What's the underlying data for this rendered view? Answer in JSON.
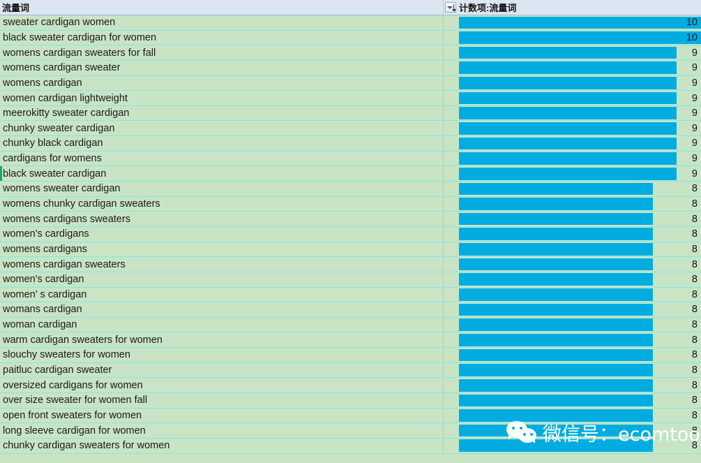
{
  "header": {
    "left_label": "流量词",
    "right_label": "计数项:流量词",
    "filter_icon": "filter-sort-dropdown-icon"
  },
  "chart_data": {
    "type": "bar",
    "title": "计数项:流量词",
    "xlabel": "",
    "ylabel": "流量词",
    "orientation": "horizontal",
    "value_column_header": "计数项:流量词",
    "category_column_header": "流量词",
    "grid": false,
    "legend": "none",
    "xlim": [
      0,
      10
    ],
    "categories": [
      "sweater cardigan women",
      "black sweater cardigan for women",
      "womens cardigan sweaters for fall",
      "womens cardigan sweater",
      "womens cardigan",
      "women cardigan lightweight",
      "meerokitty sweater cardigan",
      "chunky sweater cardigan",
      "chunky black cardigan",
      "cardigans for womens",
      "black sweater cardigan",
      "womens sweater cardigan",
      "womens chunky cardigan sweaters",
      "womens cardigans sweaters",
      "women's cardigans",
      "womens cardigans",
      "womens cardigan sweaters",
      "women's cardigan",
      "women’ s cardigan",
      "womans cardigan",
      "woman cardigan",
      "warm cardigan sweaters for women",
      "slouchy sweaters for women",
      "paitluc cardigan sweater",
      "oversized cardigans for women",
      "over size sweater for women fall",
      "open front sweaters for women",
      "long sleeve cardigan for women",
      "chunky cardigan sweaters for women"
    ],
    "values": [
      10,
      10,
      9,
      9,
      9,
      9,
      9,
      9,
      9,
      9,
      9,
      8,
      8,
      8,
      8,
      8,
      8,
      8,
      8,
      8,
      8,
      8,
      8,
      8,
      8,
      8,
      8,
      8,
      8
    ]
  },
  "selection": {
    "selected_row_index": 10,
    "selected_row_label": "black sweater cardigan"
  },
  "colors": {
    "bar": "#00ace0",
    "row_background": "#c9e4c5",
    "header_background": "#dce6f2",
    "separator": "#7fe8e8",
    "selection_border": "#21a366"
  },
  "watermark": {
    "text": "微信号：ecomtool",
    "logo": "wechat-logo-icon"
  }
}
